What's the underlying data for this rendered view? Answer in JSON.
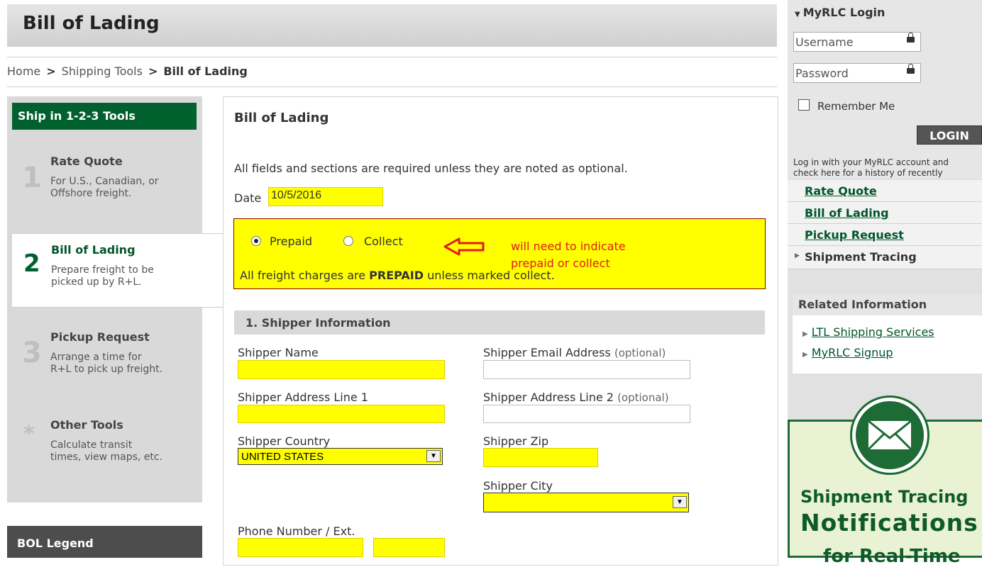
{
  "page": {
    "title": "Bill of Lading"
  },
  "breadcrumb": {
    "home": "Home",
    "sep": ">",
    "shipping_tools": "Shipping Tools",
    "current": "Bill of Lading"
  },
  "left_nav": {
    "header": "Ship in 1-2-3 Tools",
    "steps": [
      {
        "num": "1",
        "title": "Rate Quote",
        "desc1": "For U.S., Canadian, or",
        "desc2": "Offshore freight."
      },
      {
        "num": "2",
        "title": "Bill of Lading",
        "desc1": "Prepare freight to be",
        "desc2": "picked up by R+L."
      },
      {
        "num": "3",
        "title": "Pickup Request",
        "desc1": "Arrange a time for",
        "desc2": "R+L to pick up freight."
      },
      {
        "num": "*",
        "title": "Other Tools",
        "desc1": "Calculate transit",
        "desc2": "times, view maps, etc."
      }
    ],
    "legend_header": "BOL Legend"
  },
  "form": {
    "title": "Bill of Lading",
    "required_note": "All fields and sections are required unless they are noted as optional.",
    "date_label": "Date",
    "date_value": "10/5/2016",
    "payment": {
      "prepaid_label": "Prepaid",
      "collect_label": "Collect",
      "selected": "Prepaid",
      "note_prefix": "All freight charges are ",
      "note_bold": "PREPAID",
      "note_suffix": " unless marked collect.",
      "annotation_line1": "will need to indicate",
      "annotation_line2": "prepaid or collect"
    },
    "section1": {
      "title": "1. Shipper Information",
      "shipper_name": "Shipper Name",
      "shipper_email": "Shipper Email Address",
      "addr1": "Shipper Address Line 1",
      "addr2": "Shipper Address Line 2",
      "optional": "(optional)",
      "country_label": "Shipper Country",
      "country_value": "UNITED STATES",
      "zip_label": "Shipper Zip",
      "city_label": "Shipper City",
      "phone_label": "Phone Number / Ext."
    }
  },
  "login": {
    "header": "MyRLC Login",
    "username_placeholder": "Username",
    "password_placeholder": "Password",
    "remember": "Remember Me",
    "button": "LOGIN",
    "note_line1": "Log in with your MyRLC account and",
    "note_line2": "check here for a history of recently"
  },
  "right_links": [
    "Rate Quote",
    "Bill of Lading",
    "Pickup Request",
    "Shipment Tracing"
  ],
  "related": {
    "header": "Related Information",
    "items": [
      "LTL Shipping Services",
      "MyRLC Signup"
    ]
  },
  "promo": {
    "line1": "Shipment Tracing",
    "line2": "Notifications",
    "line3": "for Real-Time"
  },
  "colors": {
    "brand_green": "#00612f",
    "highlight_yellow": "#ffff00",
    "annotation_red": "#e21b1b"
  }
}
